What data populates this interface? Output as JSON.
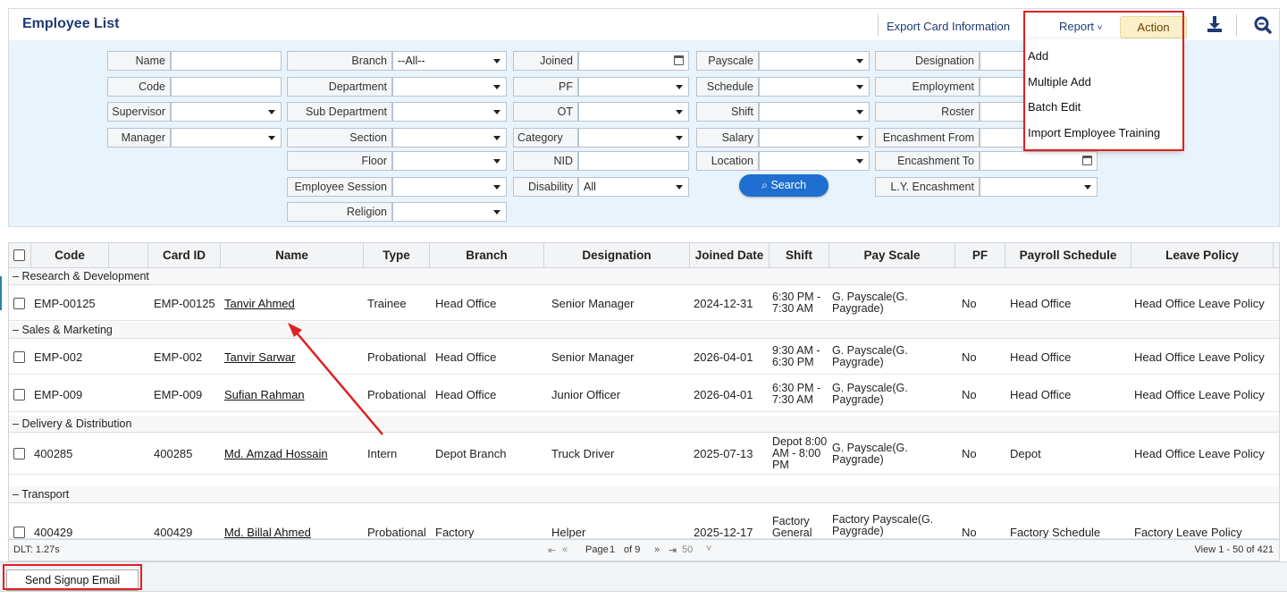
{
  "header": {
    "title": "Employee List",
    "export_label": "Export Card Information",
    "report_label": "Report",
    "action_label": "Action"
  },
  "action_menu": {
    "items": [
      "Add",
      "Multiple Add",
      "Batch Edit",
      "Import Employee Training"
    ]
  },
  "filters": {
    "name": {
      "label": "Name",
      "value": ""
    },
    "code": {
      "label": "Code",
      "value": ""
    },
    "supervisor": {
      "label": "Supervisor",
      "value": ""
    },
    "manager": {
      "label": "Manager",
      "value": ""
    },
    "branch": {
      "label": "Branch",
      "value": "--All--"
    },
    "department": {
      "label": "Department",
      "value": ""
    },
    "sub_department": {
      "label": "Sub Department",
      "value": ""
    },
    "section": {
      "label": "Section",
      "value": ""
    },
    "floor": {
      "label": "Floor",
      "value": ""
    },
    "employee_session": {
      "label": "Employee Session",
      "value": ""
    },
    "religion": {
      "label": "Religion",
      "value": ""
    },
    "joined": {
      "label": "Joined",
      "value": ""
    },
    "pf": {
      "label": "PF",
      "value": ""
    },
    "ot": {
      "label": "OT",
      "value": ""
    },
    "category": {
      "label": "Category",
      "value": ""
    },
    "nid": {
      "label": "NID",
      "value": ""
    },
    "disability": {
      "label": "Disability",
      "value": "All"
    },
    "payscale": {
      "label": "Payscale",
      "value": ""
    },
    "schedule": {
      "label": "Schedule",
      "value": ""
    },
    "shift": {
      "label": "Shift",
      "value": ""
    },
    "salary": {
      "label": "Salary",
      "value": ""
    },
    "location": {
      "label": "Location",
      "value": ""
    },
    "designation": {
      "label": "Designation",
      "value": ""
    },
    "employment": {
      "label": "Employment",
      "value": ""
    },
    "roster": {
      "label": "Roster",
      "value": ""
    },
    "encashment_from": {
      "label": "Encashment From",
      "value": ""
    },
    "encashment_to": {
      "label": "Encashment To",
      "value": ""
    },
    "ly_encashment": {
      "label": "L.Y. Encashment",
      "value": ""
    },
    "search_label": "Search"
  },
  "table": {
    "columns": [
      "Code",
      "Card ID",
      "Name",
      "Type",
      "Branch",
      "Designation",
      "Joined Date",
      "Shift",
      "Pay Scale",
      "PF",
      "Payroll Schedule",
      "Leave Policy"
    ],
    "groups": [
      {
        "name": "Research & Development",
        "rows": [
          {
            "code": "EMP-00125",
            "card_id": "EMP-00125",
            "name": "Tanvir Ahmed",
            "type": "Trainee",
            "branch": "Head Office",
            "designation": "Senior Manager",
            "joined": "2024-12-31",
            "shift": "6:30 PM - 7:30 AM",
            "payscale": "G. Payscale(G. Paygrade)",
            "pf": "No",
            "payroll": "Head Office",
            "leave": "Head Office Leave Policy"
          }
        ]
      },
      {
        "name": "Sales & Marketing",
        "rows": [
          {
            "code": "EMP-002",
            "card_id": "EMP-002",
            "name": "Tanvir Sarwar",
            "type": "Probational",
            "branch": "Head Office",
            "designation": "Senior Manager",
            "joined": "2026-04-01",
            "shift": "9:30 AM - 6:30 PM",
            "payscale": "G. Payscale(G. Paygrade)",
            "pf": "No",
            "payroll": "Head Office",
            "leave": "Head Office Leave Policy"
          },
          {
            "code": "EMP-009",
            "card_id": "EMP-009",
            "name": "Sufian Rahman",
            "type": "Probational",
            "branch": "Head Office",
            "designation": "Junior Officer",
            "joined": "2026-04-01",
            "shift": "6:30 PM - 7:30 AM",
            "payscale": "G. Payscale(G. Paygrade)",
            "pf": "No",
            "payroll": "Head Office",
            "leave": "Head Office Leave Policy"
          }
        ]
      },
      {
        "name": "Delivery & Distribution",
        "rows": [
          {
            "code": "400285",
            "card_id": "400285",
            "name": "Md. Amzad Hossain",
            "type": "Intern",
            "branch": "Depot Branch",
            "designation": "Truck Driver",
            "joined": "2025-07-13",
            "shift": "Depot 8:00 AM - 8:00 PM",
            "payscale": "G. Payscale(G. Paygrade)",
            "pf": "No",
            "payroll": "Depot",
            "leave": "Head Office Leave Policy"
          }
        ]
      },
      {
        "name": "Transport",
        "rows": [
          {
            "code": "400429",
            "card_id": "400429",
            "name": "Md. Billal Ahmed",
            "type": "Probational",
            "branch": "Factory",
            "designation": "Helper",
            "joined": "2025-12-17",
            "shift": "Factory General",
            "payscale": "Factory Payscale(G. Paygrade)",
            "pf": "No",
            "payroll": "Factory Schedule",
            "leave": "Factory Leave Policy"
          }
        ]
      }
    ]
  },
  "pager": {
    "dlt": "DLT: 1.27s",
    "page_label": "Page",
    "page": "1",
    "of_label": "of 9",
    "page_size": "50",
    "view": "View 1 - 50 of 421"
  },
  "footer": {
    "send_signup_label": "Send Signup Email"
  }
}
